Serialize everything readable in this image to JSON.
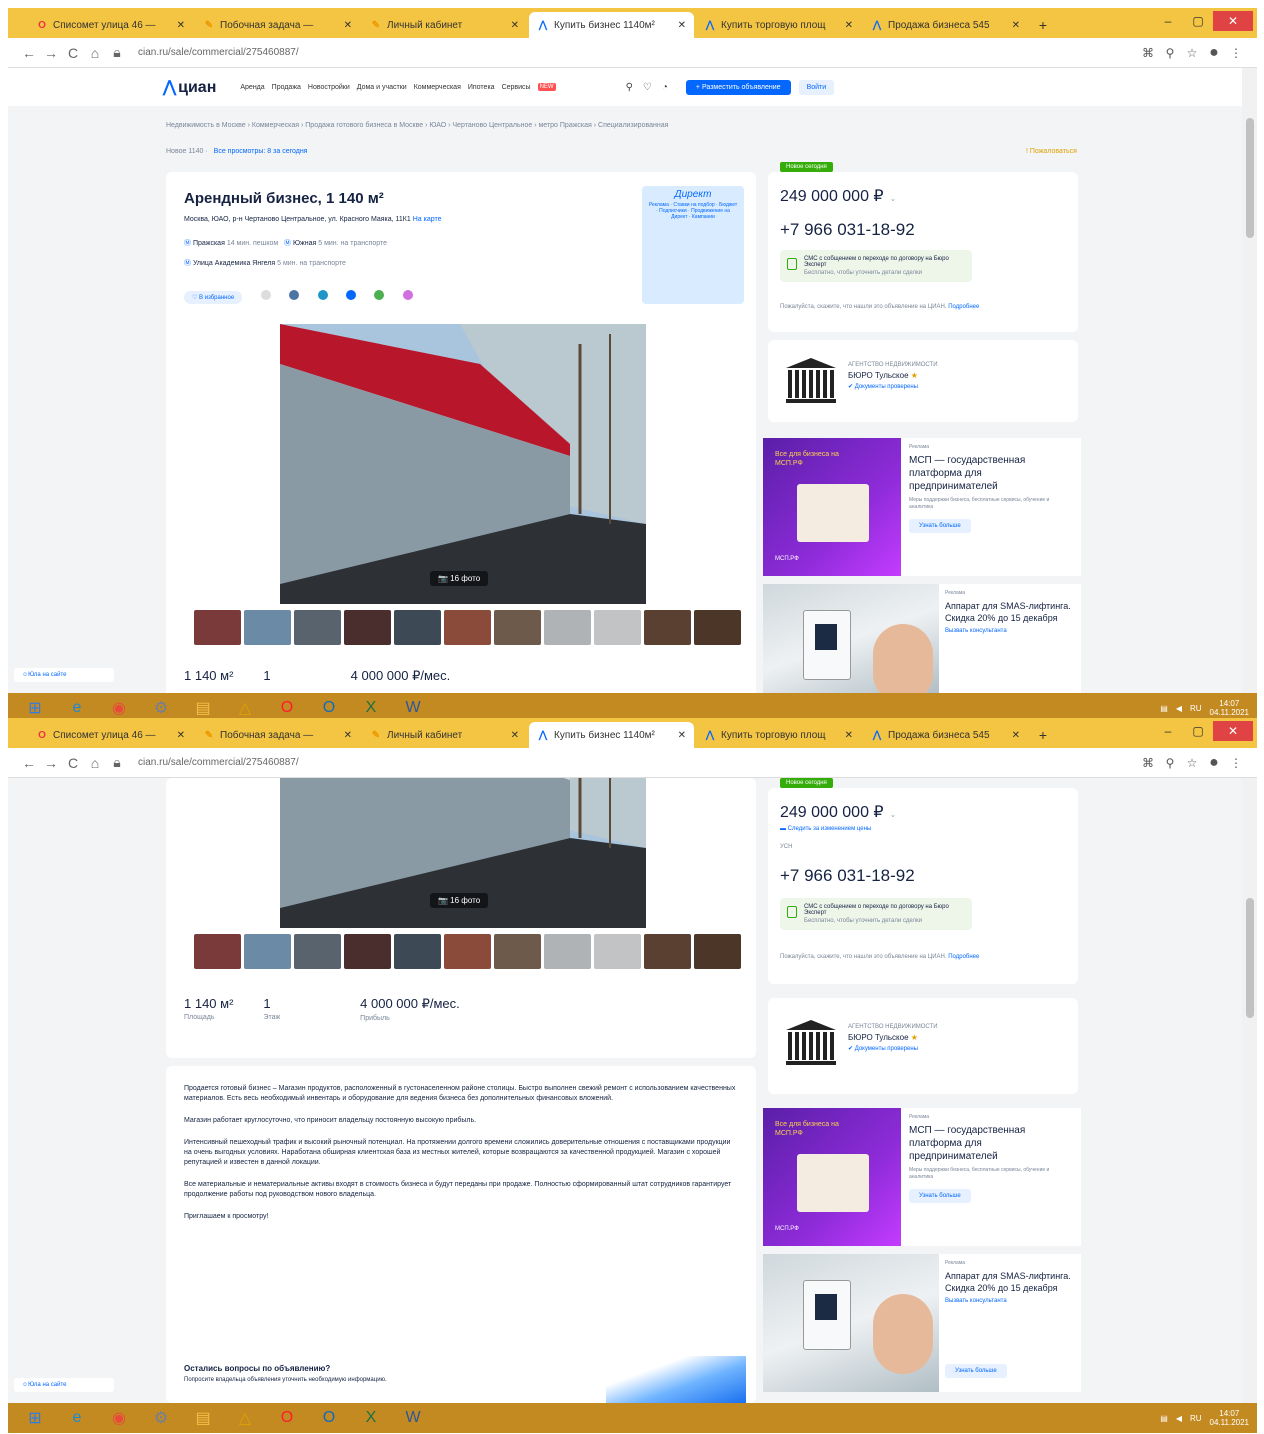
{
  "tabs": [
    {
      "icon": "O",
      "title": "Списомет улица 46 —",
      "active": false,
      "color": "#e34"
    },
    {
      "icon": "✎",
      "title": "Побочная задача —",
      "active": false,
      "color": "#e90"
    },
    {
      "icon": "✎",
      "title": "Личный кабинет",
      "active": false,
      "color": "#e90"
    },
    {
      "icon": "⋀",
      "title": "Купить бизнес 1140м²",
      "active": true,
      "color": "#0468ff"
    },
    {
      "icon": "⋀",
      "title": "Купить торговую площ",
      "active": false,
      "color": "#0468ff"
    },
    {
      "icon": "⋀",
      "title": "Продажа бизнеса 545",
      "active": false,
      "color": "#0468ff"
    }
  ],
  "new_tab": "+",
  "window_controls": {
    "minimize": "–",
    "maximize": "▢",
    "close": "✕"
  },
  "url": "cian.ru/sale/commercial/275460887/",
  "site_header": {
    "logo": "циан",
    "nav": [
      "Аренда",
      "Продажа",
      "Новостройки",
      "Дома и участки",
      "Коммерческая",
      "Ипотека",
      "Сервисы"
    ],
    "nav_badge": "NEW",
    "post_button": "+ Разместить объявление",
    "login_button": "Войти"
  },
  "breadcrumbs": "Недвижимость в Москве › Коммерческая › Продажа готового бизнеса в Москве › ЮАО › Чертаново Центральное › метро Пражская › Специализированная",
  "breadcrumbs2": "Новое 1140 ·",
  "back_link": "Все просмотры: 8 за сегодня",
  "complain": "! Пожаловаться",
  "listing": {
    "title": "Арендный бизнес, 1 140 м²",
    "address": "Москва, ЮАО, р-н Чертаново Центральное, ул. Красного Маяка, 11К1",
    "address_link": "На карте",
    "metro": [
      {
        "name": "Пражская",
        "time": "14 мин. пешком"
      },
      {
        "name": "Южная",
        "time": "5 мин. на транспорте"
      },
      {
        "name": "Улица Академика Янгеля",
        "time": "5 мин. на транспорте"
      }
    ],
    "favorite_button": "♡ В избранное",
    "ad_header": "Директ",
    "ad_lines": "Реклама · Ставки на подбор · Бюджет · Подписчики · Продвижение на Директ · Кампании",
    "photo_label": "📷 16 фото"
  },
  "stats": [
    {
      "value": "1 140 м²",
      "label": "Площадь"
    },
    {
      "value": "1",
      "label": "Этаж"
    },
    {
      "value": "4 000 000 ₽/мес.",
      "label": "Прибыль"
    }
  ],
  "side": {
    "new_label": "Новое сегодня",
    "price": "249 000 000 ₽",
    "price_change": "Следить за изменением цены",
    "tax": "УСН",
    "phone": "+7 966 031-18-92",
    "sms_title": "СМС с собщением о переходе по договору на Бюро Эксперт",
    "sms_sub": "Бесплатно, чтобы уточнить детали сделки",
    "note": "Пожалуйста, скажите, что нашли это объявление на ЦИАН.",
    "note_link": "Подробнее",
    "agency_type": "АГЕНТСТВО НЕДВИЖИМОСТИ",
    "agency_name": "БЮРО Тульское",
    "agency_verified": "Документы проверены"
  },
  "ads": [
    {
      "img_text": "Все для бизнеса на МСП.РФ",
      "logo": "МСП.РФ",
      "source": "Реклама",
      "headline": "МСП — государственная платформа для предпринимателей",
      "desc": "Меры поддержки бизнеса, бесплатные сервисы, обучение и аналитика",
      "button": "Узнать больше"
    },
    {
      "source": "Реклама",
      "headline": "Аппарат для SMAS-лифтинга. Скидка 20% до 15 декабря",
      "link": "Вызвать консультанта",
      "button": "Узнать больше"
    }
  ],
  "description": [
    "Продается готовый бизнес – Магазин продуктов, расположенный в густонаселенном районе столицы. Быстро выполнен свежий ремонт с использованием качественных материалов. Есть весь необходимый инвентарь и оборудование для ведения бизнеса без дополнительных финансовых вложений.",
    "Магазин работает круглосуточно, что приносит владельцу постоянную высокую прибыль.",
    "Интенсивный пешеходный трафик и высокий рыночный потенциал. На протяжении долгого времени сложились доверительные отношения с поставщиками продукции на очень выгодных условиях. Наработана обширная клиентская база из местных жителей, которые возвращаются за качественной продукцией. Магазин с хорошей репутацией и известен в данной локации.",
    "Все материальные и нематериальные активы входят в стоимость бизнеса и будут переданы при продаже. Полностью сформированный штат сотрудников гарантирует продолжение работы под руководством нового владельца.",
    "Приглашаем к просмотру!"
  ],
  "questions": {
    "title": "Остались вопросы по объявлению?",
    "sub": "Попросите владельца объявления уточнить необходимую информацию."
  },
  "left_widget": "Юла на сайте",
  "taskbar": {
    "icons": [
      {
        "name": "windows-start-icon",
        "glyph": "⊞",
        "color": "#2b7de9"
      },
      {
        "name": "ie-icon",
        "glyph": "e",
        "color": "#1b8ad6"
      },
      {
        "name": "chrome-icon",
        "glyph": "◉",
        "color": "#e8493b"
      },
      {
        "name": "settings-icon",
        "glyph": "⚙",
        "color": "#6f7f99"
      },
      {
        "name": "folder-icon",
        "glyph": "▤",
        "color": "#f3c046"
      },
      {
        "name": "acrobat-icon",
        "glyph": "△",
        "color": "#e0a100"
      },
      {
        "name": "opera-icon",
        "glyph": "O",
        "color": "#ff1b2d"
      },
      {
        "name": "outlook-icon",
        "glyph": "O",
        "color": "#0f6cbd"
      },
      {
        "name": "excel-icon",
        "glyph": "X",
        "color": "#1d7044"
      },
      {
        "name": "word-icon",
        "glyph": "W",
        "color": "#2b579a"
      }
    ],
    "lang": "RU",
    "time": "14:07",
    "date": "04.11.2021"
  }
}
